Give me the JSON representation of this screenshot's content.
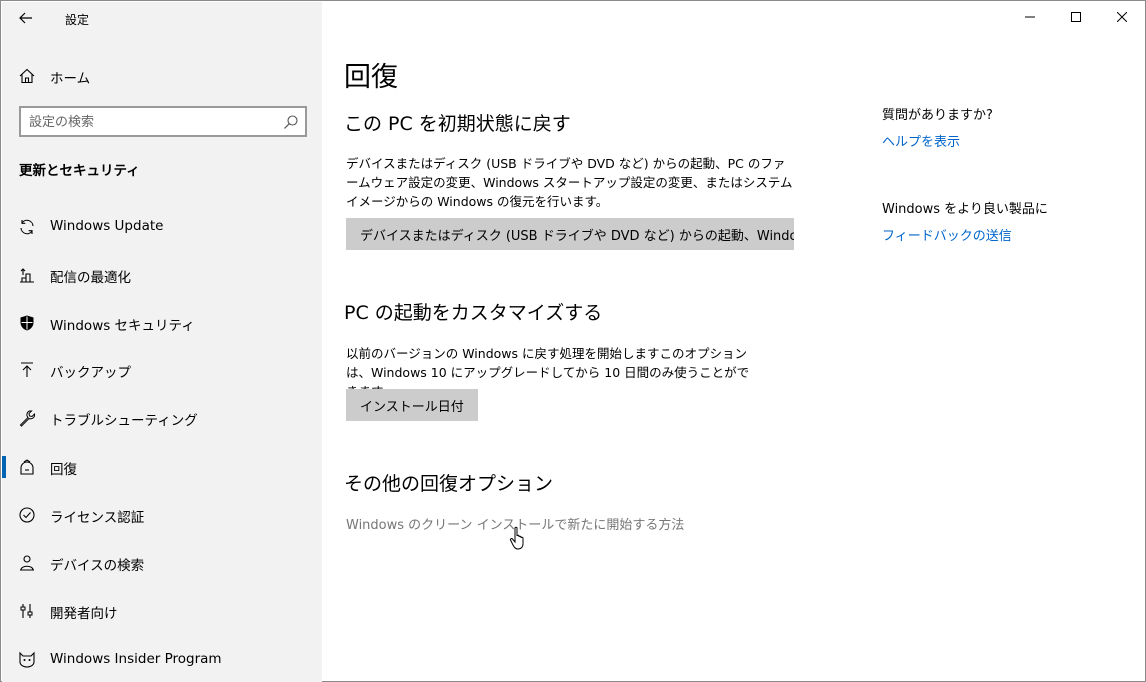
{
  "app": {
    "title": "設定"
  },
  "sidebar": {
    "home_label": "ホーム",
    "search_placeholder": "設定の検索",
    "section_title": "更新とセキュリティ",
    "items": [
      {
        "label": "Windows Update",
        "icon": "refresh-icon"
      },
      {
        "label": "配信の最適化",
        "icon": "delivery-optimization-icon"
      },
      {
        "label": "Windows セキュリティ",
        "icon": "shield-icon"
      },
      {
        "label": "バックアップ",
        "icon": "upload-arrow-icon"
      },
      {
        "label": "トラブルシューティング",
        "icon": "wrench-icon"
      },
      {
        "label": "回復",
        "icon": "recovery-icon",
        "selected": true
      },
      {
        "label": "ライセンス認証",
        "icon": "check-circle-icon"
      },
      {
        "label": "デバイスの検索",
        "icon": "person-location-icon"
      },
      {
        "label": "開発者向け",
        "icon": "developer-sliders-icon"
      },
      {
        "label": "Windows Insider Program",
        "icon": "cat-icon"
      }
    ]
  },
  "main": {
    "title": "回復",
    "reset": {
      "heading": "この PC を初期状態に戻す",
      "description": "デバイスまたはディスク (USB ドライブや DVD など) からの起動、PC のファームウェア設定の変更、Windows スタートアップ設定の変更、またはシステム イメージからの Windows の復元を行います。",
      "button_label": "デバイスまたはディスク (USB ドライブや DVD など) からの起動、Windows スタ"
    },
    "startup": {
      "heading": "PC の起動をカスタマイズする",
      "description": "以前のバージョンの Windows に戻す処理を開始しますこのオプションは、Windows 10 にアップグレードしてから 10 日間のみ使うことができます。",
      "button_label": "インストール日付"
    },
    "more": {
      "heading": "その他の回復オプション",
      "link": "Windows のクリーン インストールで新たに開始する方法"
    }
  },
  "right_panel": {
    "question": "質問がありますか?",
    "help_link": "ヘルプを表示",
    "feedback_text": "Windows をより良い製品に",
    "feedback_link": "フィードバックの送信"
  },
  "colors": {
    "accent": "#0063b1",
    "link": "#0066cc",
    "sidebar_bg": "#f2f2f2",
    "button_bg": "#cccccc"
  }
}
